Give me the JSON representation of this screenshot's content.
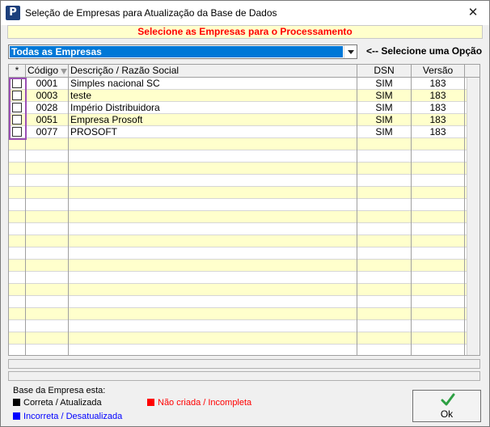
{
  "window": {
    "title": "Seleção de Empresas para Atualização da Base de Dados",
    "icon_letter": "P",
    "close_glyph": "✕"
  },
  "banner": {
    "text": "Selecione as Empresas para o Processamento",
    "color": "#ff0000"
  },
  "filter": {
    "selected": "Todas as Empresas",
    "hint": "<-- Selecione uma Opção"
  },
  "grid": {
    "columns": [
      "*",
      "Código",
      "Descrição / Razão Social",
      "DSN",
      "Versão"
    ],
    "sort_column": "Código",
    "rows": [
      {
        "checked": false,
        "codigo": "0001",
        "descricao": "Simples nacional SC",
        "dsn": "SIM",
        "versao": "183"
      },
      {
        "checked": false,
        "codigo": "0003",
        "descricao": "teste",
        "dsn": "SIM",
        "versao": "183"
      },
      {
        "checked": false,
        "codigo": "0028",
        "descricao": "Império Distribuidora",
        "dsn": "SIM",
        "versao": "183"
      },
      {
        "checked": false,
        "codigo": "0051",
        "descricao": "Empresa Prosoft",
        "dsn": "SIM",
        "versao": "183"
      },
      {
        "checked": false,
        "codigo": "0077",
        "descricao": "PROSOFT",
        "dsn": "SIM",
        "versao": "183"
      }
    ],
    "row_colors": {
      "even": "#ffffcc",
      "odd": "#ffffff"
    }
  },
  "legend": {
    "title": "Base da Empresa esta:",
    "items": [
      {
        "label": "Correta / Atualizada",
        "color": "#000000"
      },
      {
        "label": "Incorreta / Desatualizada",
        "color": "#0000ff"
      },
      {
        "label": "Não criada / Incompleta",
        "color": "#ff0000"
      }
    ]
  },
  "ok_button": {
    "label": "Ok",
    "icon": "check-icon",
    "icon_color": "#2ea043"
  }
}
